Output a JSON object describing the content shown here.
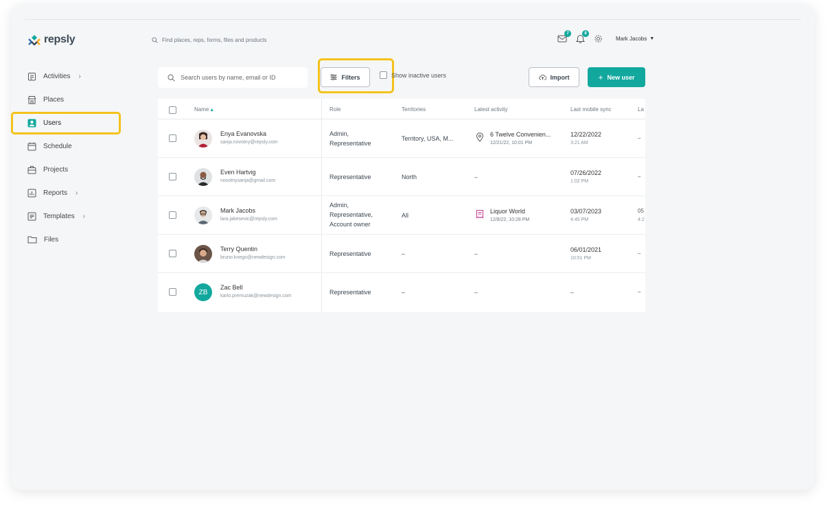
{
  "app": {
    "brand": "repsly"
  },
  "header": {
    "search_placeholder": "Find places, reps, forms, files and products",
    "messages_count": "7",
    "notifications_count": "8",
    "user_name": "Mark Jacobs"
  },
  "sidebar": {
    "items": [
      {
        "label": "Activities",
        "icon": "clipboard-icon",
        "has_submenu": true
      },
      {
        "label": "Places",
        "icon": "store-icon",
        "has_submenu": false
      },
      {
        "label": "Users",
        "icon": "user-icon",
        "has_submenu": false,
        "active": true
      },
      {
        "label": "Schedule",
        "icon": "calendar-icon",
        "has_submenu": false
      },
      {
        "label": "Projects",
        "icon": "briefcase-icon",
        "has_submenu": false
      },
      {
        "label": "Reports",
        "icon": "chart-icon",
        "has_submenu": true
      },
      {
        "label": "Templates",
        "icon": "template-icon",
        "has_submenu": true
      },
      {
        "label": "Files",
        "icon": "folder-icon",
        "has_submenu": false
      }
    ]
  },
  "toolbar": {
    "search_placeholder": "Search users by name, email or ID",
    "filters_label": "Filters",
    "show_inactive_label": "Show inactive users",
    "import_label": "Import",
    "new_user_label": "New user"
  },
  "table": {
    "columns": {
      "name": "Name",
      "role": "Role",
      "territories": "Territories",
      "latest_activity": "Latest activity",
      "last_mobile_sync": "Last mobile sync",
      "extra": "La"
    },
    "rows": [
      {
        "name": "Enya Evanovska",
        "email": "sanja.novotny@repsly.com",
        "role_lines": [
          "Admin,",
          "Representative"
        ],
        "territories": "Territory, USA, M...",
        "activity_name": "6 Twelve Convenien...",
        "activity_time": "12/21/22, 10:01 PM",
        "activity_icon": "location-pin-icon",
        "sync_date": "12/22/2022",
        "sync_time": "3:21 AM",
        "extra": "–"
      },
      {
        "name": "Even Hartvig",
        "email": "novotnysanja@gmail.com",
        "role_lines": [
          "Representative"
        ],
        "territories": "North",
        "activity_name": "–",
        "activity_time": "",
        "sync_date": "07/26/2022",
        "sync_time": "1:02 PM",
        "extra": "–"
      },
      {
        "name": "Mark Jacobs",
        "email": "lara.jakesevic@repsly.com",
        "role_lines": [
          "Admin,",
          "Representative,",
          "Account owner"
        ],
        "territories": "All",
        "activity_name": "Liquor World",
        "activity_time": "12/8/22, 10:28 PM",
        "activity_icon": "receipt-icon",
        "sync_date": "03/07/2023",
        "sync_time": "4:45 PM",
        "extra": "05",
        "extra_sub": "4:2"
      },
      {
        "name": "Terry Quentin",
        "email": "bruno.knego@newdesign.com",
        "role_lines": [
          "Representative"
        ],
        "territories": "–",
        "activity_name": "–",
        "activity_time": "",
        "sync_date": "06/01/2021",
        "sync_time": "10:51 PM",
        "extra": "–"
      },
      {
        "name": "Zac Bell",
        "initials": "ZB",
        "email": "karlo.premuzak@newdesign.com",
        "role_lines": [
          "Representative"
        ],
        "territories": "–",
        "activity_name": "–",
        "activity_time": "",
        "sync_date": "–",
        "sync_time": "",
        "extra": "–"
      }
    ]
  },
  "colors": {
    "accent": "#13a89e",
    "highlight": "#f4c21a",
    "receipt": "#c2398f"
  }
}
